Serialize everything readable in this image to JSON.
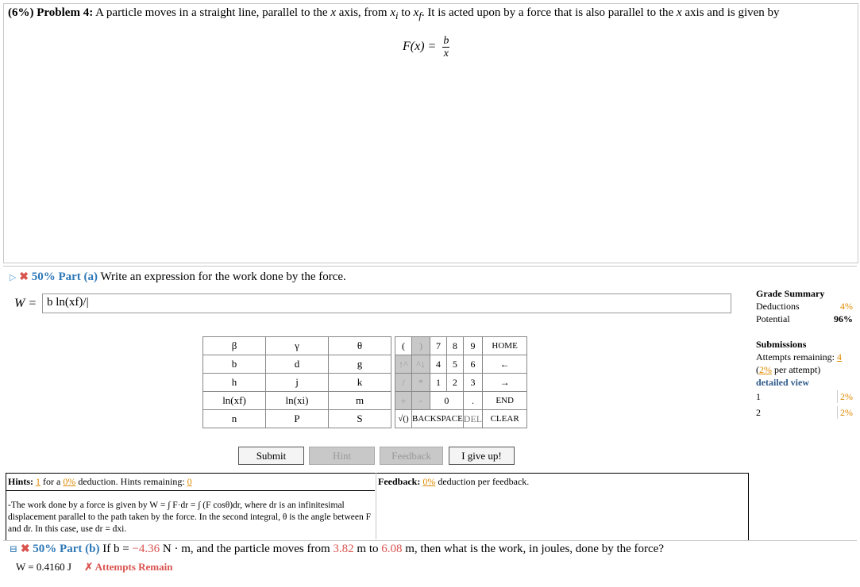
{
  "problem": {
    "weight": "(6%)",
    "label": "Problem 4:",
    "statement_start": "A particle moves in a straight line, parallel to the ",
    "statement_x": "x",
    "statement_mid1": " axis, from ",
    "xi": "x",
    "xi_sub": "i",
    "to": " to ",
    "xf": "x",
    "xf_sub": "f",
    "statement_mid2": ". It is acted upon by a force that is also parallel to the ",
    "statement_x2": "x",
    "statement_end": " axis and is given by",
    "formula_lhs": "F(x) = ",
    "formula_num": "b",
    "formula_den": "x"
  },
  "partA": {
    "weight": "50% Part (a)",
    "question": "Write an expression for the work done by the force.",
    "w_label": "W =",
    "answer_value": "b ln(xf)/|"
  },
  "grade": {
    "title": "Grade Summary",
    "deductions_label": "Deductions",
    "deductions_value": "4%",
    "potential_label": "Potential",
    "potential_value": "96%",
    "submissions_title": "Submissions",
    "attempts_label": "Attempts remaining:",
    "attempts_value": "4",
    "per_attempt_pct": "2%",
    "per_attempt_label": "per attempt)",
    "detailed_view": "detailed view",
    "rows": [
      {
        "n": "1",
        "v": "2%"
      },
      {
        "n": "2",
        "v": "2%"
      }
    ]
  },
  "keypad": {
    "vars": [
      [
        "β",
        "γ",
        "θ"
      ],
      [
        "b",
        "d",
        "g"
      ],
      [
        "h",
        "j",
        "k"
      ],
      [
        "ln(xf)",
        "ln(xi)",
        "m"
      ],
      [
        "n",
        "P",
        "S"
      ]
    ],
    "row1": [
      "(",
      ")",
      "7",
      "8",
      "9",
      "HOME"
    ],
    "row2": [
      "↑^",
      "^↓",
      "4",
      "5",
      "6",
      "←"
    ],
    "row3": [
      "/",
      "*",
      "1",
      "2",
      "3",
      "→"
    ],
    "row4": [
      "+",
      "-",
      "0",
      ".",
      "END"
    ],
    "row5": [
      "√()",
      "BACKSPACE",
      "DEL",
      "CLEAR"
    ]
  },
  "buttons": {
    "submit": "Submit",
    "hint": "Hint",
    "feedback": "Feedback",
    "give_up": "I give up!"
  },
  "hints": {
    "label": "Hints:",
    "count": "1",
    "for_a": "for a",
    "pct": "0%",
    "deduction": "deduction. Hints remaining:",
    "remaining": "0",
    "text": "-The work done by a force is given by W = ∫ F·dr = ∫ (F cosθ)dr, where dr is an infinitesimal displacement parallel to the path taken by the force. In the second integral, θ is the angle between F and dr. In this case, use dr = dxi."
  },
  "feedback": {
    "label": "Feedback:",
    "pct": "0%",
    "text": "deduction per feedback."
  },
  "partB": {
    "weight": "50% Part (b)",
    "q1": "If b = ",
    "b_val": "−4.36",
    "q2": " N · m, and the particle moves from ",
    "xi_val": "3.82",
    "q3": " m to ",
    "xf_val": "6.08",
    "q4": " m, then what is the work, in joules, done by the force?",
    "w_result": "W = 0.4160 J",
    "attempts": "✗ Attempts Remain"
  },
  "colors": {
    "accent_blue": "#2e78b7",
    "red": "#d9534f",
    "orange": "#e08a00"
  }
}
